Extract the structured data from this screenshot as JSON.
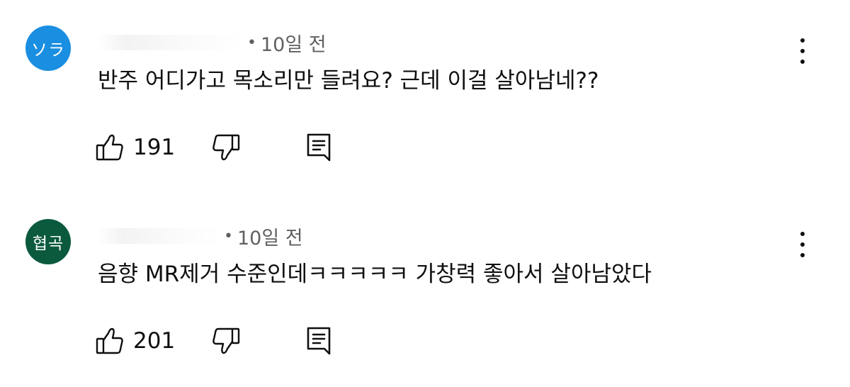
{
  "comments": [
    {
      "avatar_text": "ソラ",
      "avatar_color": "#1a8ee0",
      "timestamp": "10일 전",
      "text": "반주 어디가고 목소리만 들려요? 근데 이걸 살아남네??",
      "likes": "191",
      "icons": [
        "thumbs-up-icon",
        "thumbs-down-icon",
        "reply-icon",
        "more-vert-icon"
      ]
    },
    {
      "avatar_text": "협곡",
      "avatar_color": "#0b5a3e",
      "timestamp": "10일 전",
      "text": "음향  MR제거 수준인데ㅋㅋㅋㅋㅋ 가창력 좋아서 살아남았다",
      "likes": "201",
      "icons": [
        "thumbs-up-icon",
        "thumbs-down-icon",
        "reply-icon",
        "more-vert-icon"
      ]
    }
  ],
  "separator": "•"
}
